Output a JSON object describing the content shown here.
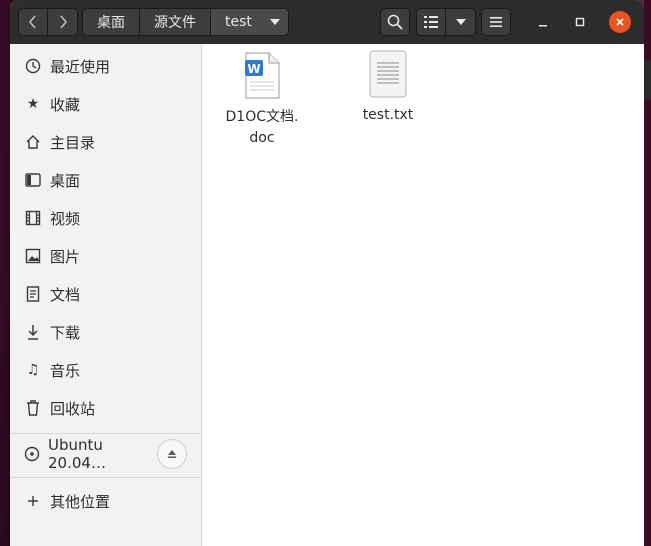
{
  "headerbar": {
    "back_icon": "chevron-left-icon",
    "forward_icon": "chevron-right-icon",
    "path": [
      "桌面",
      "源文件",
      "test"
    ],
    "search_icon": "search-icon",
    "view_icon": "list-view-icon",
    "menu_icon": "hamburger-menu-icon"
  },
  "window": {
    "close_color": "#e95420"
  },
  "sidebar": {
    "items": [
      {
        "label": "最近使用",
        "icon": "clock-icon"
      },
      {
        "label": "收藏",
        "icon": "star-icon"
      },
      {
        "label": "主目录",
        "icon": "home-icon"
      },
      {
        "label": "桌面",
        "icon": "desktop-icon"
      },
      {
        "label": "视频",
        "icon": "film-icon"
      },
      {
        "label": "图片",
        "icon": "image-icon"
      },
      {
        "label": "文档",
        "icon": "document-icon"
      },
      {
        "label": "下载",
        "icon": "download-icon"
      },
      {
        "label": "音乐",
        "icon": "music-icon"
      },
      {
        "label": "回收站",
        "icon": "trash-icon"
      }
    ],
    "device": {
      "label": "Ubuntu 20.04…",
      "icon": "disc-icon",
      "eject_icon": "eject-icon"
    },
    "other": {
      "label": "其他位置",
      "icon": "plus-icon"
    }
  },
  "files": [
    {
      "name_line1": "D1OC文档.",
      "name_line2": "doc",
      "icon": "word-document-icon",
      "badge": "W"
    },
    {
      "name_line1": "test.txt",
      "name_line2": "",
      "icon": "text-file-icon"
    }
  ]
}
